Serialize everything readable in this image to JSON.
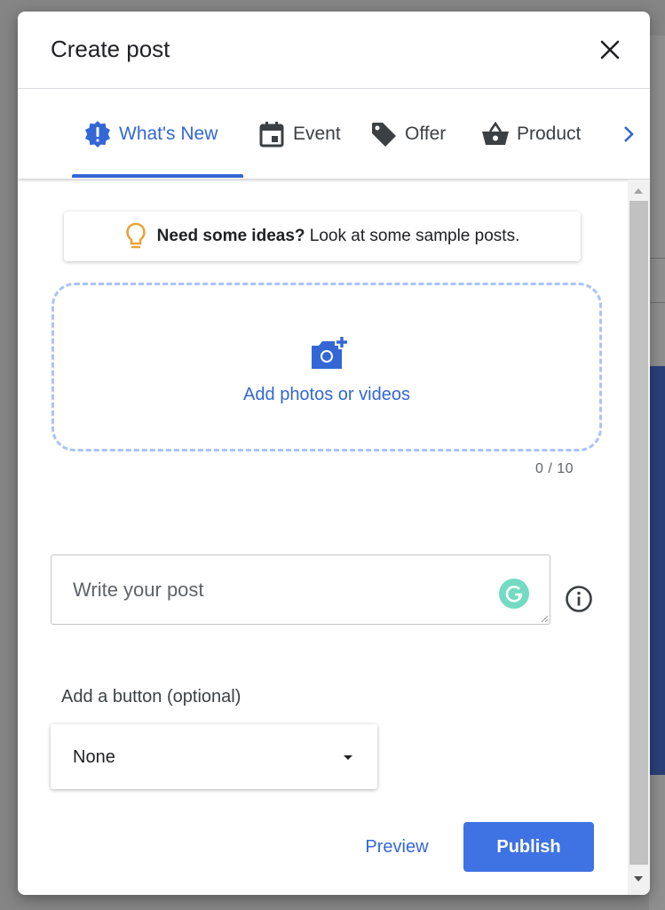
{
  "dialog": {
    "title": "Create post"
  },
  "tabs": [
    {
      "label": "What's New",
      "icon": "whats-new-badge-icon",
      "active": true
    },
    {
      "label": "Event",
      "icon": "calendar-icon",
      "active": false
    },
    {
      "label": "Offer",
      "icon": "tag-icon",
      "active": false
    },
    {
      "label": "Product",
      "icon": "basket-icon",
      "active": false
    }
  ],
  "ideas": {
    "bold": "Need some ideas?",
    "rest": " Look at some sample posts.",
    "icon": "lightbulb-icon"
  },
  "upload": {
    "label": "Add photos or videos",
    "counter": "0 / 10",
    "icon": "add-photo-icon"
  },
  "post": {
    "placeholder": "Write your post"
  },
  "button_section": {
    "label": "Add a button (optional)",
    "selected": "None"
  },
  "actions": {
    "preview": "Preview",
    "publish": "Publish"
  },
  "colors": {
    "accent": "#3367d6",
    "publish_bg": "#3f72e3",
    "upload_border": "#a9c4f5",
    "bulb": "#e8a33b",
    "grammarly": "#15c39a"
  }
}
